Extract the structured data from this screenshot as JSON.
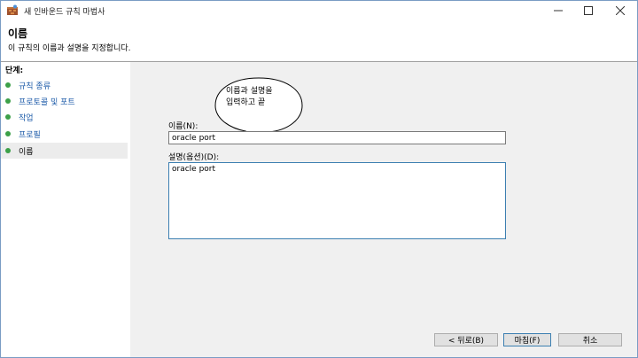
{
  "window": {
    "title": "새 인바운드 규칙 마법사"
  },
  "header": {
    "title": "이름",
    "subtitle": "이 규칙의 이름과 설명을 지정합니다."
  },
  "sidebar": {
    "steps_label": "단계:",
    "items": [
      {
        "label": "규칙 종류"
      },
      {
        "label": "프로토콜 및 포트"
      },
      {
        "label": "작업"
      },
      {
        "label": "프로필"
      },
      {
        "label": "이름"
      }
    ]
  },
  "callout": {
    "line1": "이름과 설명을",
    "line2": "입력하고 끝"
  },
  "form": {
    "name_label": "이름(N):",
    "name_value": "oracle port",
    "desc_label": "설명(옵션)(D):",
    "desc_value": "oracle port"
  },
  "buttons": {
    "back": "< 뒤로(B)",
    "finish": "마침(F)",
    "cancel": "취소"
  },
  "colors": {
    "link": "#1b5aa8",
    "bullet": "#3ca048",
    "focus_border": "#3c7fb1"
  },
  "icons": {
    "app": "firewall-app-icon",
    "minimize": "minimize-icon",
    "maximize": "maximize-icon",
    "close": "close-icon"
  }
}
